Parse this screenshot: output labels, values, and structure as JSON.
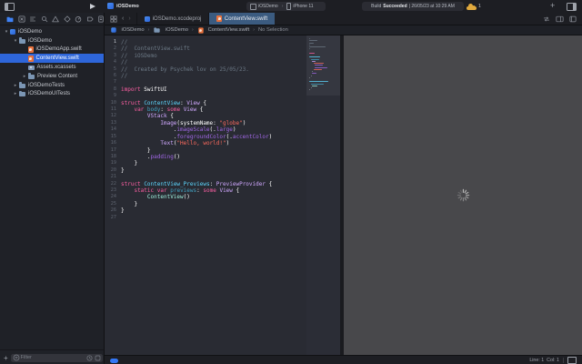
{
  "window": {
    "title": "iOSDemo"
  },
  "toolbar": {
    "scheme": "iOSDemo",
    "destination": "iPhone 11",
    "build_label": "Build",
    "build_status": "Succeeded",
    "build_time": "| 26/05/23 at 10:29 AM",
    "warning_count": "1"
  },
  "navigator": {
    "icons": [
      "project",
      "source-control",
      "symbols",
      "find",
      "issues",
      "tests",
      "debug",
      "breakpoints",
      "reports"
    ],
    "tree": [
      {
        "label": "iOSDemo",
        "icon": "app",
        "level": 0,
        "exp": "open",
        "selected": false
      },
      {
        "label": "iOSDemo",
        "icon": "folder",
        "level": 1,
        "exp": "open",
        "selected": false
      },
      {
        "label": "iOSDemoApp.swift",
        "icon": "swift",
        "level": 2,
        "exp": "none",
        "selected": false
      },
      {
        "label": "ContentView.swift",
        "icon": "swift",
        "level": 2,
        "exp": "none",
        "selected": true
      },
      {
        "label": "Assets.xcassets",
        "icon": "assets",
        "level": 2,
        "exp": "none",
        "selected": false
      },
      {
        "label": "Preview Content",
        "icon": "folder",
        "level": 2,
        "exp": "closed",
        "selected": false
      },
      {
        "label": "iOSDemoTests",
        "icon": "folder",
        "level": 1,
        "exp": "closed",
        "selected": false
      },
      {
        "label": "iOSDemoUITests",
        "icon": "folder",
        "level": 1,
        "exp": "closed",
        "selected": false
      }
    ],
    "filter_placeholder": "Filter"
  },
  "editor": {
    "tabs": [
      {
        "label": "iOSDemo.xcodeproj",
        "icon": "app",
        "active": false
      },
      {
        "label": "ContentView.swift",
        "icon": "swift",
        "active": true
      }
    ],
    "breadcrumbs": [
      {
        "label": "iOSDemo",
        "icon": "app"
      },
      {
        "label": "iOSDemo",
        "icon": "folder"
      },
      {
        "label": "ContentView.swift",
        "icon": "swift"
      },
      {
        "label": "No Selection",
        "icon": "none"
      }
    ],
    "code": {
      "colors": {
        "plain": "#ffffff",
        "comment": "#6c7986",
        "keyword": "#fc5fa3",
        "string": "#fc6a5d",
        "typeDecl": "#5dd8ff",
        "propDecl": "#41a1c0",
        "sdkType": "#d0a8ff",
        "sdkFn": "#a167e6",
        "projType": "#9ef1dd"
      },
      "lines": [
        [
          [
            "comment",
            "//"
          ]
        ],
        [
          [
            "comment",
            "//  ContentView.swift"
          ]
        ],
        [
          [
            "comment",
            "//  iOSDemo"
          ]
        ],
        [
          [
            "comment",
            "//"
          ]
        ],
        [
          [
            "comment",
            "//  Created by Psychek lov on 25/05/23."
          ]
        ],
        [
          [
            "comment",
            "//"
          ]
        ],
        [],
        [
          [
            "keyword",
            "import"
          ],
          [
            "plain",
            " SwiftUI"
          ]
        ],
        [],
        [
          [
            "keyword",
            "struct"
          ],
          [
            "plain",
            " "
          ],
          [
            "typeDecl",
            "ContentView"
          ],
          [
            "plain",
            ": "
          ],
          [
            "sdkType",
            "View"
          ],
          [
            "plain",
            " {"
          ]
        ],
        [
          [
            "plain",
            "    "
          ],
          [
            "keyword",
            "var"
          ],
          [
            "plain",
            " "
          ],
          [
            "propDecl",
            "body"
          ],
          [
            "plain",
            ": "
          ],
          [
            "keyword",
            "some"
          ],
          [
            "plain",
            " "
          ],
          [
            "sdkType",
            "View"
          ],
          [
            "plain",
            " {"
          ]
        ],
        [
          [
            "plain",
            "        "
          ],
          [
            "sdkType",
            "VStack"
          ],
          [
            "plain",
            " {"
          ]
        ],
        [
          [
            "plain",
            "            "
          ],
          [
            "sdkType",
            "Image"
          ],
          [
            "plain",
            "(systemName: "
          ],
          [
            "string",
            "\"globe\""
          ],
          [
            "plain",
            ")"
          ]
        ],
        [
          [
            "plain",
            "                ."
          ],
          [
            "sdkFn",
            "imageScale"
          ],
          [
            "plain",
            "(."
          ],
          [
            "sdkFn",
            "large"
          ],
          [
            "plain",
            ")"
          ]
        ],
        [
          [
            "plain",
            "                ."
          ],
          [
            "sdkFn",
            "foregroundColor"
          ],
          [
            "plain",
            "(."
          ],
          [
            "sdkFn",
            "accentColor"
          ],
          [
            "plain",
            ")"
          ]
        ],
        [
          [
            "plain",
            "            "
          ],
          [
            "sdkType",
            "Text"
          ],
          [
            "plain",
            "("
          ],
          [
            "string",
            "\"Hello, world!\""
          ],
          [
            "plain",
            ")"
          ]
        ],
        [
          [
            "plain",
            "        }"
          ]
        ],
        [
          [
            "plain",
            "        ."
          ],
          [
            "sdkFn",
            "padding"
          ],
          [
            "plain",
            "()"
          ]
        ],
        [
          [
            "plain",
            "    }"
          ]
        ],
        [
          [
            "plain",
            "}"
          ]
        ],
        [],
        [
          [
            "keyword",
            "struct"
          ],
          [
            "plain",
            " "
          ],
          [
            "typeDecl",
            "ContentView_Previews"
          ],
          [
            "plain",
            ": "
          ],
          [
            "sdkType",
            "PreviewProvider"
          ],
          [
            "plain",
            " {"
          ]
        ],
        [
          [
            "plain",
            "    "
          ],
          [
            "keyword",
            "static"
          ],
          [
            "plain",
            " "
          ],
          [
            "keyword",
            "var"
          ],
          [
            "plain",
            " "
          ],
          [
            "propDecl",
            "previews"
          ],
          [
            "plain",
            ": "
          ],
          [
            "keyword",
            "some"
          ],
          [
            "plain",
            " "
          ],
          [
            "sdkType",
            "View"
          ],
          [
            "plain",
            " {"
          ]
        ],
        [
          [
            "plain",
            "        "
          ],
          [
            "projType",
            "ContentView"
          ],
          [
            "plain",
            "()"
          ]
        ],
        [
          [
            "plain",
            "    }"
          ]
        ],
        [
          [
            "plain",
            "}"
          ]
        ],
        []
      ]
    }
  },
  "statusbar": {
    "line_col": "Line: 1  Col: 1"
  },
  "canvas": {
    "state": "loading"
  }
}
